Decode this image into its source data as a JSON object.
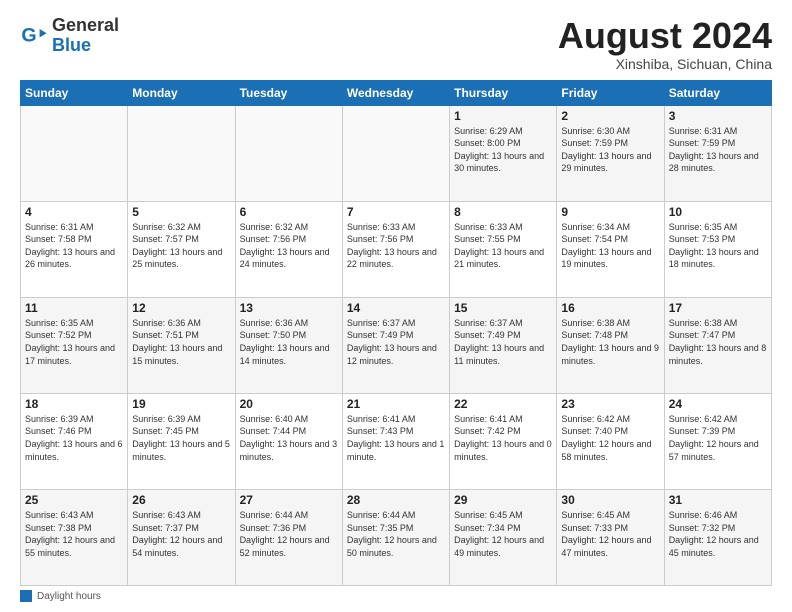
{
  "header": {
    "logo_line1": "General",
    "logo_line2": "Blue",
    "main_title": "August 2024",
    "subtitle": "Xinshiba, Sichuan, China"
  },
  "days_of_week": [
    "Sunday",
    "Monday",
    "Tuesday",
    "Wednesday",
    "Thursday",
    "Friday",
    "Saturday"
  ],
  "weeks": [
    [
      {
        "day": "",
        "detail": ""
      },
      {
        "day": "",
        "detail": ""
      },
      {
        "day": "",
        "detail": ""
      },
      {
        "day": "",
        "detail": ""
      },
      {
        "day": "1",
        "detail": "Sunrise: 6:29 AM\nSunset: 8:00 PM\nDaylight: 13 hours\nand 30 minutes."
      },
      {
        "day": "2",
        "detail": "Sunrise: 6:30 AM\nSunset: 7:59 PM\nDaylight: 13 hours\nand 29 minutes."
      },
      {
        "day": "3",
        "detail": "Sunrise: 6:31 AM\nSunset: 7:59 PM\nDaylight: 13 hours\nand 28 minutes."
      }
    ],
    [
      {
        "day": "4",
        "detail": "Sunrise: 6:31 AM\nSunset: 7:58 PM\nDaylight: 13 hours\nand 26 minutes."
      },
      {
        "day": "5",
        "detail": "Sunrise: 6:32 AM\nSunset: 7:57 PM\nDaylight: 13 hours\nand 25 minutes."
      },
      {
        "day": "6",
        "detail": "Sunrise: 6:32 AM\nSunset: 7:56 PM\nDaylight: 13 hours\nand 24 minutes."
      },
      {
        "day": "7",
        "detail": "Sunrise: 6:33 AM\nSunset: 7:56 PM\nDaylight: 13 hours\nand 22 minutes."
      },
      {
        "day": "8",
        "detail": "Sunrise: 6:33 AM\nSunset: 7:55 PM\nDaylight: 13 hours\nand 21 minutes."
      },
      {
        "day": "9",
        "detail": "Sunrise: 6:34 AM\nSunset: 7:54 PM\nDaylight: 13 hours\nand 19 minutes."
      },
      {
        "day": "10",
        "detail": "Sunrise: 6:35 AM\nSunset: 7:53 PM\nDaylight: 13 hours\nand 18 minutes."
      }
    ],
    [
      {
        "day": "11",
        "detail": "Sunrise: 6:35 AM\nSunset: 7:52 PM\nDaylight: 13 hours\nand 17 minutes."
      },
      {
        "day": "12",
        "detail": "Sunrise: 6:36 AM\nSunset: 7:51 PM\nDaylight: 13 hours\nand 15 minutes."
      },
      {
        "day": "13",
        "detail": "Sunrise: 6:36 AM\nSunset: 7:50 PM\nDaylight: 13 hours\nand 14 minutes."
      },
      {
        "day": "14",
        "detail": "Sunrise: 6:37 AM\nSunset: 7:49 PM\nDaylight: 13 hours\nand 12 minutes."
      },
      {
        "day": "15",
        "detail": "Sunrise: 6:37 AM\nSunset: 7:49 PM\nDaylight: 13 hours\nand 11 minutes."
      },
      {
        "day": "16",
        "detail": "Sunrise: 6:38 AM\nSunset: 7:48 PM\nDaylight: 13 hours\nand 9 minutes."
      },
      {
        "day": "17",
        "detail": "Sunrise: 6:38 AM\nSunset: 7:47 PM\nDaylight: 13 hours\nand 8 minutes."
      }
    ],
    [
      {
        "day": "18",
        "detail": "Sunrise: 6:39 AM\nSunset: 7:46 PM\nDaylight: 13 hours\nand 6 minutes."
      },
      {
        "day": "19",
        "detail": "Sunrise: 6:39 AM\nSunset: 7:45 PM\nDaylight: 13 hours\nand 5 minutes."
      },
      {
        "day": "20",
        "detail": "Sunrise: 6:40 AM\nSunset: 7:44 PM\nDaylight: 13 hours\nand 3 minutes."
      },
      {
        "day": "21",
        "detail": "Sunrise: 6:41 AM\nSunset: 7:43 PM\nDaylight: 13 hours\nand 1 minute."
      },
      {
        "day": "22",
        "detail": "Sunrise: 6:41 AM\nSunset: 7:42 PM\nDaylight: 13 hours\nand 0 minutes."
      },
      {
        "day": "23",
        "detail": "Sunrise: 6:42 AM\nSunset: 7:40 PM\nDaylight: 12 hours\nand 58 minutes."
      },
      {
        "day": "24",
        "detail": "Sunrise: 6:42 AM\nSunset: 7:39 PM\nDaylight: 12 hours\nand 57 minutes."
      }
    ],
    [
      {
        "day": "25",
        "detail": "Sunrise: 6:43 AM\nSunset: 7:38 PM\nDaylight: 12 hours\nand 55 minutes."
      },
      {
        "day": "26",
        "detail": "Sunrise: 6:43 AM\nSunset: 7:37 PM\nDaylight: 12 hours\nand 54 minutes."
      },
      {
        "day": "27",
        "detail": "Sunrise: 6:44 AM\nSunset: 7:36 PM\nDaylight: 12 hours\nand 52 minutes."
      },
      {
        "day": "28",
        "detail": "Sunrise: 6:44 AM\nSunset: 7:35 PM\nDaylight: 12 hours\nand 50 minutes."
      },
      {
        "day": "29",
        "detail": "Sunrise: 6:45 AM\nSunset: 7:34 PM\nDaylight: 12 hours\nand 49 minutes."
      },
      {
        "day": "30",
        "detail": "Sunrise: 6:45 AM\nSunset: 7:33 PM\nDaylight: 12 hours\nand 47 minutes."
      },
      {
        "day": "31",
        "detail": "Sunrise: 6:46 AM\nSunset: 7:32 PM\nDaylight: 12 hours\nand 45 minutes."
      }
    ]
  ],
  "footer": {
    "legend_label": "Daylight hours"
  }
}
